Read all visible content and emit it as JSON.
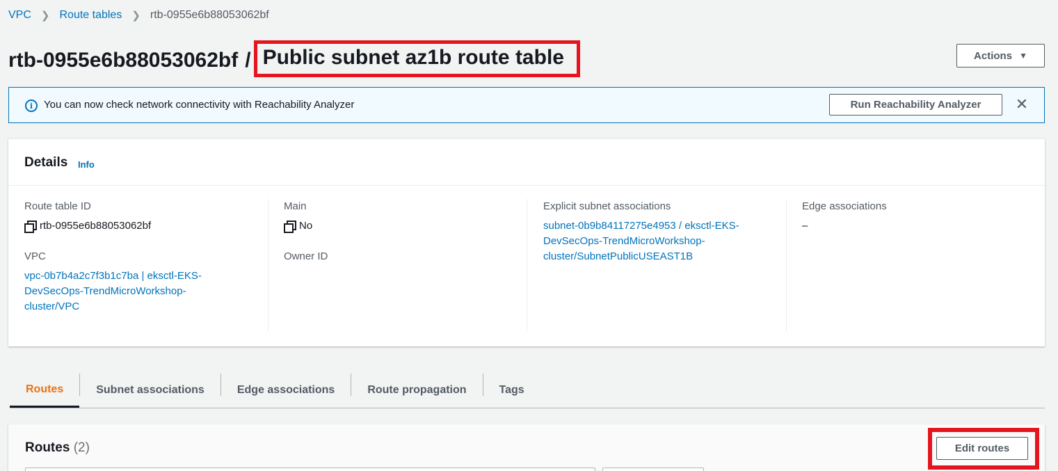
{
  "breadcrumb": {
    "items": [
      "VPC",
      "Route tables"
    ],
    "current": "rtb-0955e6b88053062bf"
  },
  "header": {
    "id": "rtb-0955e6b88053062bf",
    "separator": "/",
    "name": "Public subnet az1b route table",
    "actions_label": "Actions"
  },
  "banner": {
    "message": "You can now check network connectivity with Reachability Analyzer",
    "button_label": "Run Reachability Analyzer"
  },
  "details": {
    "title": "Details",
    "info_label": "Info",
    "route_table_id_label": "Route table ID",
    "route_table_id": "rtb-0955e6b88053062bf",
    "vpc_label": "VPC",
    "vpc_value": "vpc-0b7b4a2c7f3b1c7ba | eksctl-EKS-DevSecOps-TrendMicroWorkshop-cluster/VPC",
    "main_label": "Main",
    "main_value": "No",
    "owner_label": "Owner ID",
    "subnet_assoc_label": "Explicit subnet associations",
    "subnet_assoc_value": "subnet-0b9b84117275e4953 / eksctl-EKS-DevSecOps-TrendMicroWorkshop-cluster/SubnetPublicUSEAST1B",
    "edge_label": "Edge associations",
    "edge_value": "–"
  },
  "tabs": [
    {
      "label": "Routes",
      "active": true
    },
    {
      "label": "Subnet associations",
      "active": false
    },
    {
      "label": "Edge associations",
      "active": false
    },
    {
      "label": "Route propagation",
      "active": false
    },
    {
      "label": "Tags",
      "active": false
    }
  ],
  "routes": {
    "title": "Routes",
    "count": "(2)",
    "edit_label": "Edit routes"
  },
  "colors": {
    "link": "#0073bb",
    "active_tab": "#ec7211",
    "highlight": "#e5141e"
  }
}
